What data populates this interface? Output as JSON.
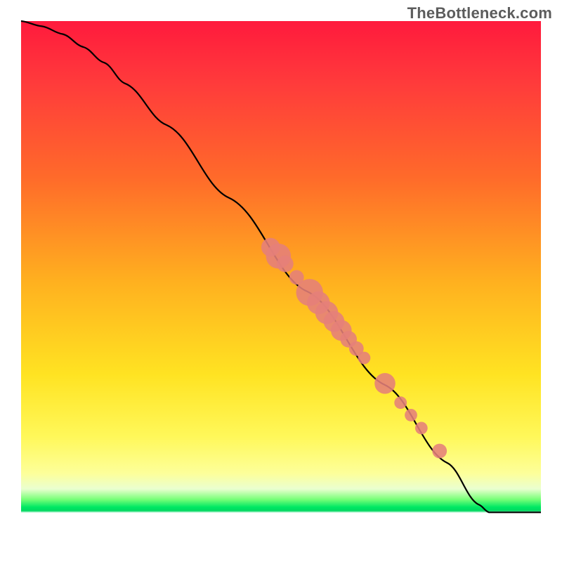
{
  "branding": {
    "watermark": "TheBottleneck.com"
  },
  "chart_data": {
    "type": "line",
    "title": "",
    "xlabel": "",
    "ylabel": "",
    "xlim": [
      0,
      100
    ],
    "ylim": [
      0,
      100
    ],
    "grid": false,
    "legend": false,
    "series": [
      {
        "name": "curve",
        "kind": "line",
        "color": "#000000",
        "x": [
          0,
          4,
          8,
          12,
          16,
          20,
          28,
          40,
          55,
          70,
          82,
          88,
          90,
          100
        ],
        "y": [
          100,
          99,
          97.5,
          95,
          92,
          88,
          80,
          66,
          48,
          30,
          15,
          7,
          5.5,
          5.5
        ]
      },
      {
        "name": "highlighted-points",
        "kind": "scatter",
        "color": "#e57f7a",
        "points": [
          {
            "x": 48.0,
            "y": 56.5,
            "r": 1.8
          },
          {
            "x": 49.5,
            "y": 54.8,
            "r": 2.4
          },
          {
            "x": 50.8,
            "y": 53.3,
            "r": 1.6
          },
          {
            "x": 53.0,
            "y": 50.7,
            "r": 1.4
          },
          {
            "x": 55.5,
            "y": 47.8,
            "r": 2.6
          },
          {
            "x": 57.2,
            "y": 45.8,
            "r": 2.2
          },
          {
            "x": 58.8,
            "y": 43.9,
            "r": 2.2
          },
          {
            "x": 60.2,
            "y": 42.2,
            "r": 2.0
          },
          {
            "x": 61.6,
            "y": 40.5,
            "r": 2.0
          },
          {
            "x": 63.0,
            "y": 38.8,
            "r": 1.6
          },
          {
            "x": 64.5,
            "y": 37.0,
            "r": 1.4
          },
          {
            "x": 66.0,
            "y": 35.2,
            "r": 1.2
          },
          {
            "x": 70.0,
            "y": 30.3,
            "r": 2.0
          },
          {
            "x": 73.0,
            "y": 26.6,
            "r": 1.2
          },
          {
            "x": 75.0,
            "y": 24.2,
            "r": 1.2
          },
          {
            "x": 77.0,
            "y": 21.7,
            "r": 1.2
          },
          {
            "x": 80.5,
            "y": 17.3,
            "r": 1.4
          }
        ]
      }
    ],
    "background": {
      "type": "vertical-gradient",
      "stops": [
        {
          "pos": 0.0,
          "color": "#ff1a3d"
        },
        {
          "pos": 0.3,
          "color": "#ff6a2a"
        },
        {
          "pos": 0.68,
          "color": "#ffe322"
        },
        {
          "pos": 0.9,
          "color": "#eaffd0"
        },
        {
          "pos": 0.935,
          "color": "#00e864"
        },
        {
          "pos": 0.946,
          "color": "#ffffff"
        },
        {
          "pos": 1.0,
          "color": "#ffffff"
        }
      ]
    }
  }
}
